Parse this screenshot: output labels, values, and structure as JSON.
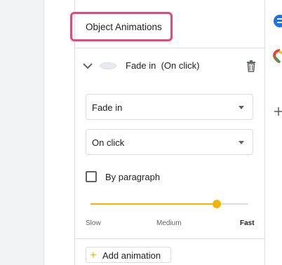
{
  "panel": {
    "title": "Object Animations"
  },
  "animation_item": {
    "label": "Fade in  (On click)"
  },
  "effect_select": {
    "value": "Fade in"
  },
  "trigger_select": {
    "value": "On click"
  },
  "by_paragraph": {
    "label": "By paragraph",
    "checked": false
  },
  "speed_slider": {
    "value_fraction": 0.8,
    "labels": {
      "slow": "Slow",
      "medium": "Medium",
      "fast": "Fast"
    }
  },
  "add_animation": {
    "label": "Add animation"
  },
  "colors": {
    "highlight": "#e8457a",
    "accent": "#f4b400"
  },
  "icons": {
    "chevron": "chevron-down-icon",
    "trash": "trash-icon",
    "add": "plus-icon"
  }
}
